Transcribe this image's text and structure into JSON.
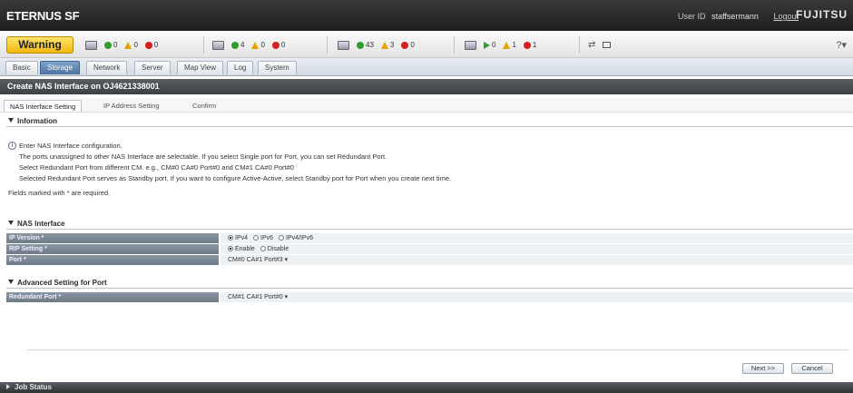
{
  "header": {
    "brand": "ETERNUS SF",
    "user_label": "User ID",
    "user_id": "staffsermann",
    "logout": "Logout",
    "vendor": "FUJITSU"
  },
  "status": {
    "overall": "Warning",
    "overall_color": "#f3b810",
    "groups": [
      {
        "icon": "server-icon",
        "normal": "0",
        "warning": "0",
        "error": "0"
      },
      {
        "icon": "switch-icon",
        "normal": "4",
        "warning": "0",
        "error": "0"
      },
      {
        "icon": "storage-icon",
        "normal": "43",
        "warning": "3",
        "error": "0"
      },
      {
        "icon": "job-icon",
        "running": "0",
        "warning": "1",
        "error": "1"
      }
    ],
    "help": "?"
  },
  "nav": {
    "tabs": [
      "Basic",
      "Storage",
      "Network",
      "Server",
      "Map View",
      "Log",
      "System"
    ],
    "active": "Storage"
  },
  "page": {
    "title": "Create NAS Interface on OJ4621338001"
  },
  "wizard": {
    "steps": [
      "NAS Interface Setting",
      "IP Address Setting",
      "Confirm"
    ]
  },
  "information": {
    "header": "Information",
    "lines": [
      "Enter NAS Interface configuration.",
      "The ports unassigned to other NAS Interface are selectable. If you select Single port for Port, you can set Redundant Port.",
      "Select Redundant Port from different CM. e.g., CM#0 CA#0 Port#0 and CM#1 CA#0 Port#0",
      "Selected Redundant Port serves as Standby port. If you want to configure Active-Active, select Standby port for Port when you create next time.",
      "Fields marked with * are required."
    ]
  },
  "nas_interface": {
    "header": "NAS Interface",
    "ip_version_label": "IP Version *",
    "ip_options": [
      "IPv4",
      "IPv6",
      "IPv4/IPv6"
    ],
    "rip_label": "RIP Setting *",
    "rip_options": [
      "Enable",
      "Disable"
    ],
    "port_label": "Port *",
    "port_value": "CM#0 CA#1 Port#3"
  },
  "advanced": {
    "header": "Advanced Setting for Port",
    "redundant_label": "Redundant Port *",
    "redundant_value": "CM#1 CA#1 Port#0"
  },
  "buttons": {
    "next": "Next >>",
    "cancel": "Cancel"
  },
  "footer": {
    "job_status": "Job Status"
  }
}
